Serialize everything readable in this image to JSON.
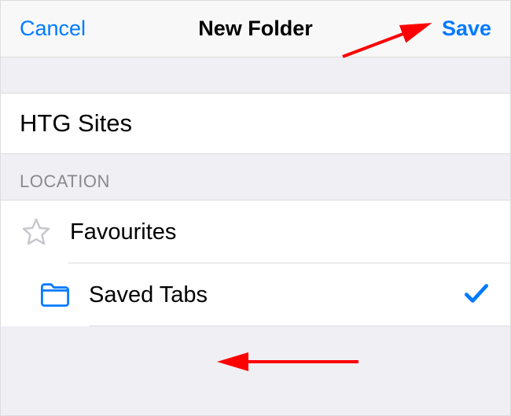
{
  "nav": {
    "cancel_label": "Cancel",
    "title": "New Folder",
    "save_label": "Save"
  },
  "folder_name": {
    "value": "HTG Sites"
  },
  "location": {
    "section_header": "LOCATION",
    "items": [
      {
        "label": "Favourites",
        "icon": "star",
        "selected": false
      },
      {
        "label": "Saved Tabs",
        "icon": "folder",
        "selected": true
      }
    ]
  },
  "colors": {
    "tint": "#007aff",
    "link": "#007aff",
    "check": "#007aff",
    "arrow": "#ff0000"
  }
}
